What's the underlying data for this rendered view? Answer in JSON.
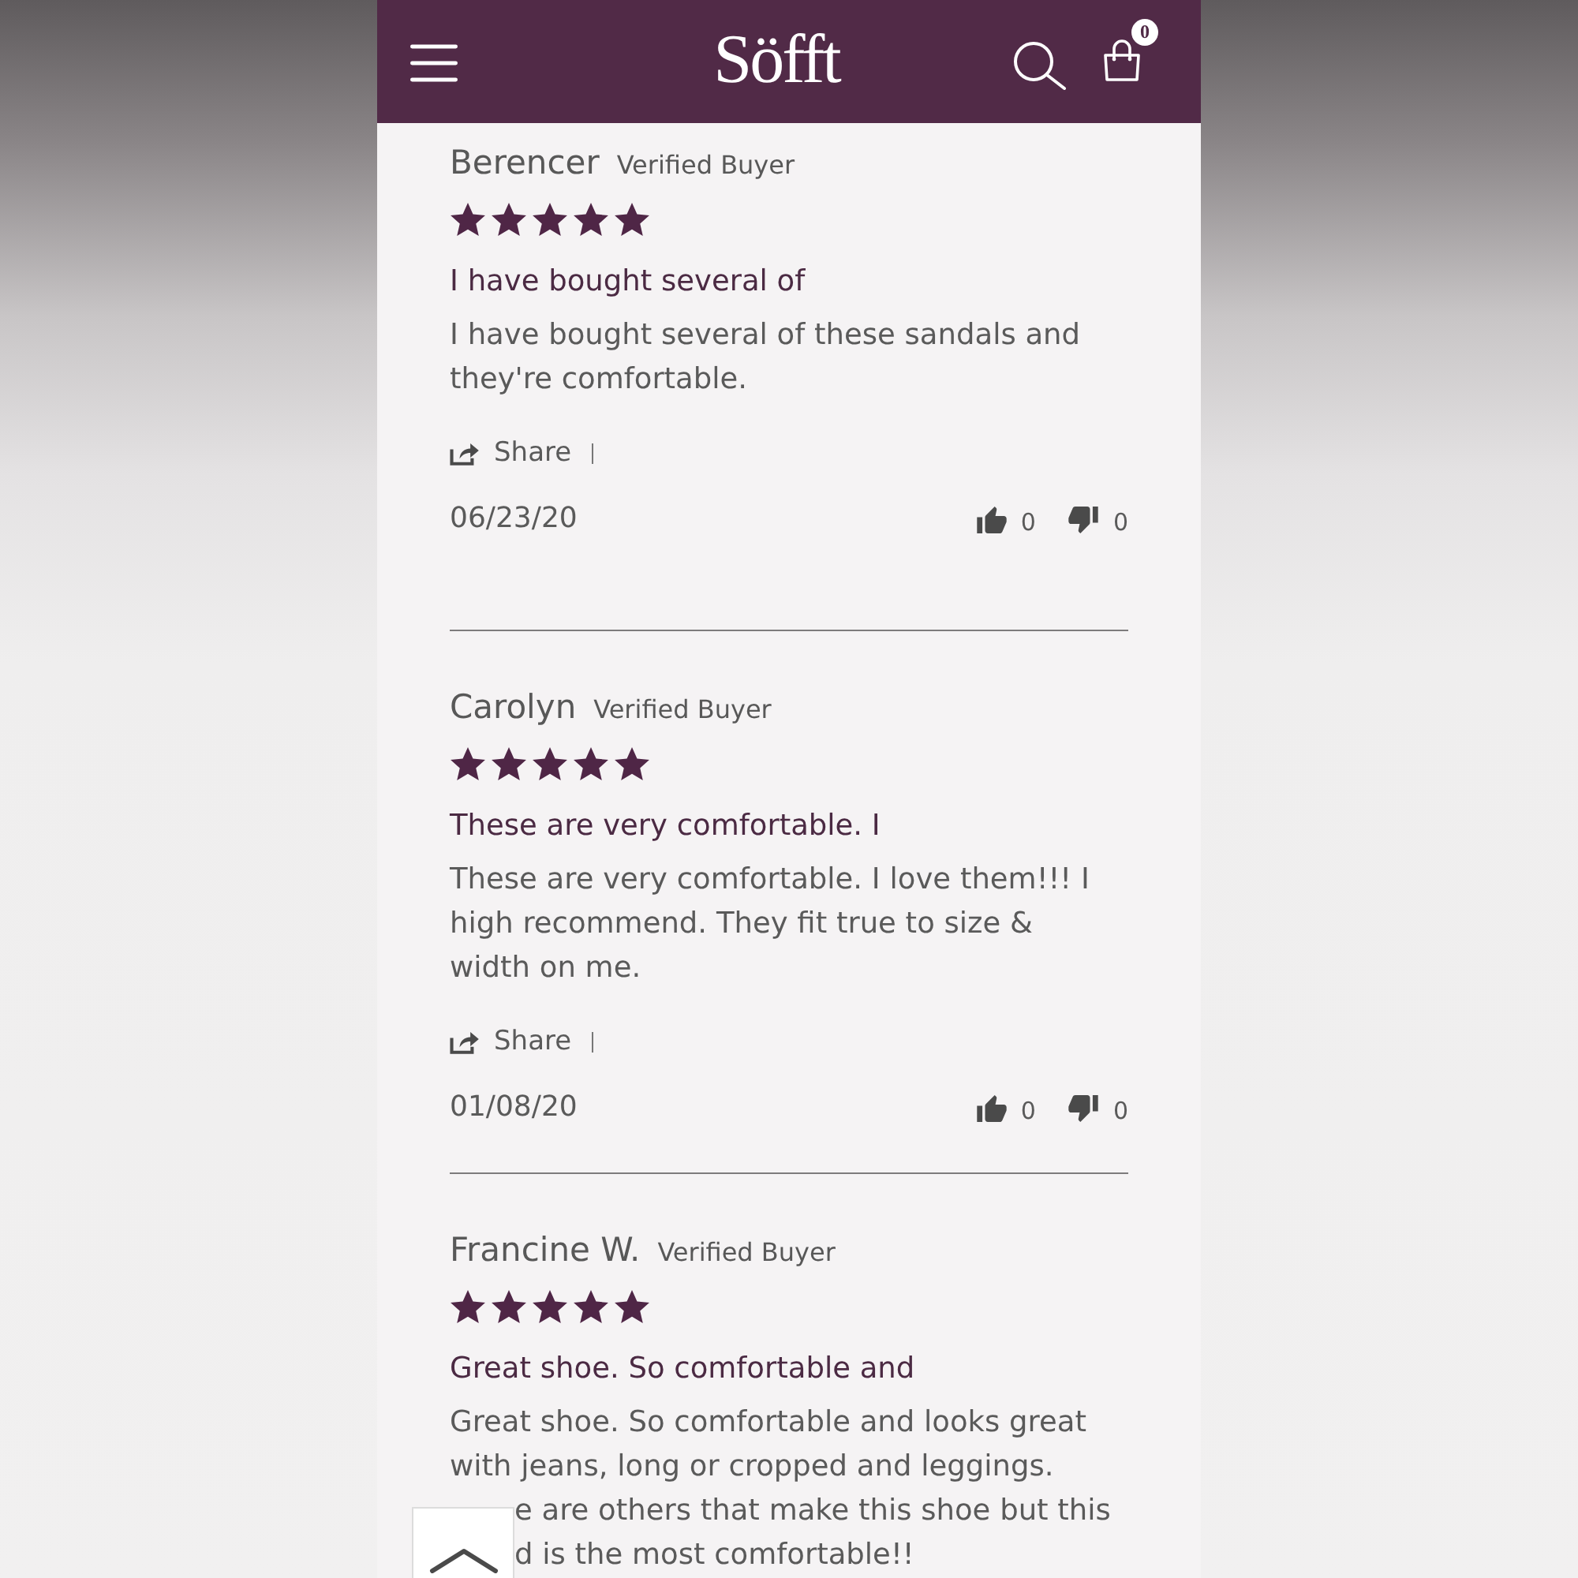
{
  "header": {
    "logo": "Söfft",
    "cart_count": "0"
  },
  "reviews": [
    {
      "name": "Berencer",
      "badge": "Verified Buyer",
      "stars": 5,
      "title": "I have bought several of",
      "body": "I have bought several of these sandals and they're comfortable.",
      "share": "Share",
      "date": "06/23/20",
      "likes": "0",
      "dislikes": "0"
    },
    {
      "name": "Carolyn",
      "badge": "Verified Buyer",
      "stars": 5,
      "title": "These are very comfortable. I",
      "body": "These are very comfortable. I love them!!! I high recommend. They fit true to size & width on me.",
      "share": "Share",
      "date": "01/08/20",
      "likes": "0",
      "dislikes": "0"
    },
    {
      "name": "Francine W.",
      "badge": "Verified Buyer",
      "stars": 5,
      "title": "Great shoe. So comfortable and",
      "body": "Great shoe. So comfortable and looks great with jeans, long or cropped and leggings.",
      "body_cut_lines": [
        "e are others that make this shoe but this",
        "d is the most comfortable!!"
      ]
    }
  ]
}
